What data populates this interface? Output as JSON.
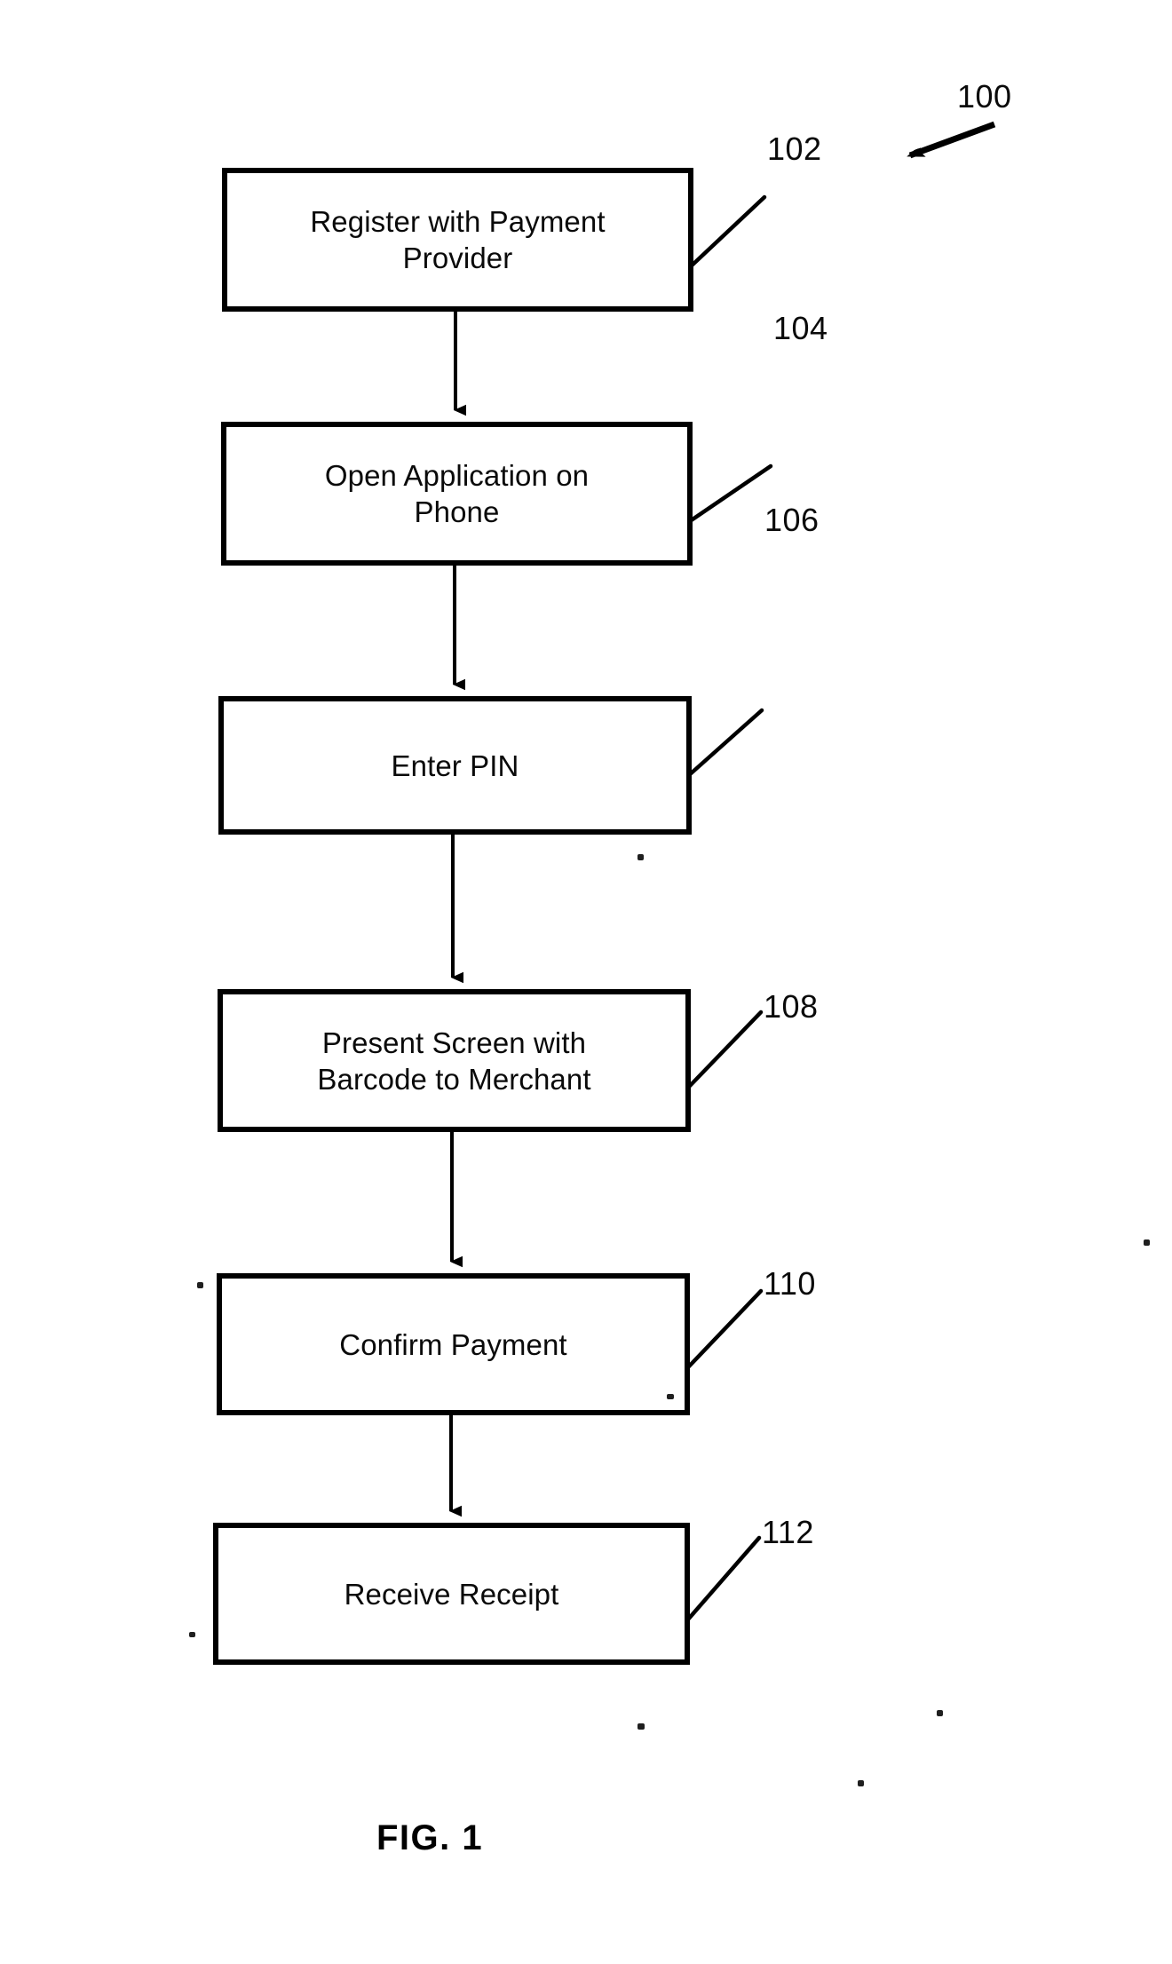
{
  "figure": {
    "caption": "FIG. 1",
    "system_ref": "100",
    "title": "Payment process flowchart"
  },
  "flowchart": {
    "type": "flowchart",
    "orientation": "vertical",
    "nodes": [
      {
        "id": "102",
        "ref": "102",
        "label": "Register with Payment\nProvider",
        "line1": "Register with Payment",
        "line2": "Provider"
      },
      {
        "id": "104",
        "ref": "104",
        "label": "Open Application on\nPhone",
        "line1": "Open Application on",
        "line2": "Phone"
      },
      {
        "id": "106",
        "ref": "106",
        "label": "Enter PIN",
        "line1": "Enter PIN",
        "line2": ""
      },
      {
        "id": "108",
        "ref": "108",
        "label": "Present Screen with\nBarcode to Merchant",
        "line1": "Present Screen with",
        "line2": "Barcode to Merchant"
      },
      {
        "id": "110",
        "ref": "110",
        "label": "Confirm Payment",
        "line1": "Confirm Payment",
        "line2": ""
      },
      {
        "id": "112",
        "ref": "112",
        "label": "Receive Receipt",
        "line1": "Receive Receipt",
        "line2": ""
      }
    ],
    "edges": [
      {
        "from": "102",
        "to": "104"
      },
      {
        "from": "104",
        "to": "106"
      },
      {
        "from": "106",
        "to": "108"
      },
      {
        "from": "108",
        "to": "110"
      },
      {
        "from": "110",
        "to": "112"
      }
    ],
    "colors": {
      "stroke": "#000000",
      "fill": "#ffffff",
      "text": "#0a0a0a",
      "background": "#ffffff"
    }
  }
}
